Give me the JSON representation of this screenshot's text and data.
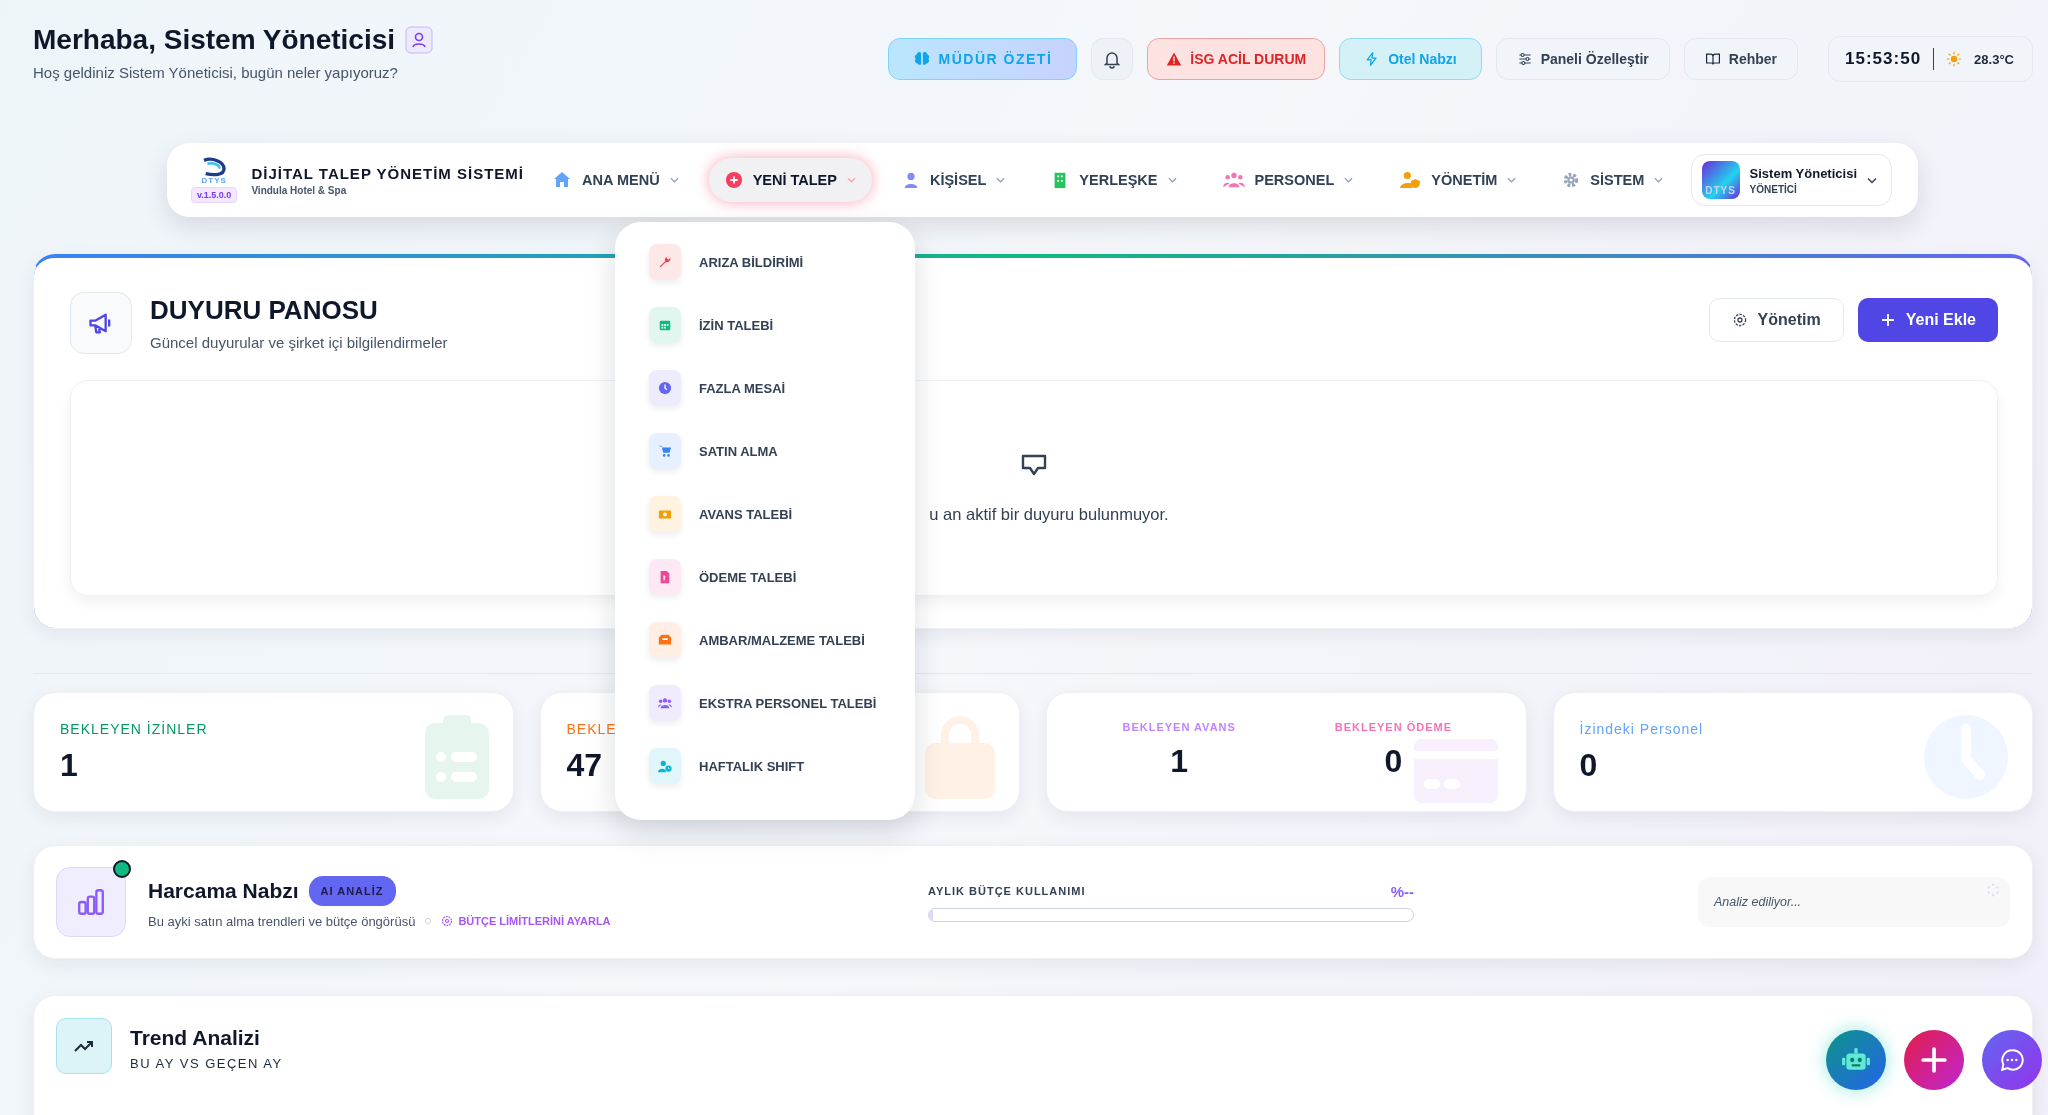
{
  "greeting": {
    "title": "Merhaba, Sistem Yöneticisi",
    "subtitle": "Hoş geldiniz Sistem Yöneticisi, bugün neler yapıyoruz?"
  },
  "top_actions": [
    {
      "kind": "summary",
      "label": "MÜDÜR ÖZETİ"
    },
    {
      "kind": "bell"
    },
    {
      "kind": "alert",
      "label": "İSG ACİL DURUM"
    },
    {
      "kind": "pulse",
      "label": "Otel Nabzı"
    },
    {
      "kind": "customize",
      "label": "Paneli Özelleştir"
    },
    {
      "kind": "guide",
      "label": "Rehber"
    }
  ],
  "status": {
    "time": "15:53:50",
    "temperature": "28.3°C"
  },
  "nav": {
    "logo_text": "DTYS",
    "version": "v.1.5.0.0",
    "title": "DİJİTAL TALEP YÖNETİM SİSTEMİ",
    "subtitle": "Vindula Hotel & Spa",
    "items": [
      {
        "kind": "home",
        "label": "ANA MENÜ",
        "selected": false
      },
      {
        "kind": "new",
        "label": "YENİ TALEP",
        "selected": true
      },
      {
        "kind": "person",
        "label": "KİŞİSEL",
        "selected": false
      },
      {
        "kind": "building",
        "label": "YERLEŞKE",
        "selected": false
      },
      {
        "kind": "people",
        "label": "PERSONEL",
        "selected": false
      },
      {
        "kind": "admin",
        "label": "YÖNETİM",
        "selected": false
      },
      {
        "kind": "gear",
        "label": "SİSTEM",
        "selected": false
      }
    ],
    "user": {
      "avatar_text": "DTYS",
      "name": "Sistem Yöneticisi",
      "role": "YÖNETİCİ"
    }
  },
  "dropdown": [
    {
      "kind": "wrench",
      "label": "ARIZA BİLDİRİMİ",
      "color": "#ef4444"
    },
    {
      "kind": "calendar",
      "label": "İZİN TALEBİ",
      "color": "#10b981"
    },
    {
      "kind": "clock",
      "label": "FAZLA MESAİ",
      "color": "#6366f1"
    },
    {
      "kind": "cart",
      "label": "SATIN ALMA",
      "color": "#3b82f6"
    },
    {
      "kind": "money",
      "label": "AVANS TALEBİ",
      "color": "#f59e0b"
    },
    {
      "kind": "doc",
      "label": "ÖDEME TALEBİ",
      "color": "#ec4899"
    },
    {
      "kind": "box",
      "label": "AMBAR/MALZEME TALEBİ",
      "color": "#f97316"
    },
    {
      "kind": "people",
      "label": "EKSTRA PERSONEL TALEBİ",
      "color": "#8b5cf6"
    },
    {
      "kind": "userclock",
      "label": "HAFTALIK SHIFT",
      "color": "#06b6d4"
    }
  ],
  "announcements": {
    "title": "DUYURU PANOSU",
    "subtitle": "Güncel duyurular ve şirket içi bilgilendirmeler",
    "buttons": [
      {
        "kind": "secondary",
        "label": "Yönetim"
      },
      {
        "kind": "primary",
        "label": "Yeni Ekle"
      }
    ],
    "empty_text": "u an aktif bir duyuru bulunmuyor."
  },
  "stats": [
    {
      "kind": "single",
      "label": "BEKLEYEN İZİNLER",
      "value": "1",
      "color": "#059669"
    },
    {
      "kind": "single",
      "label": "BEKLE",
      "value": "47",
      "color": "#f97316"
    },
    {
      "kind": "double",
      "parts": [
        {
          "label": "BEKLEYEN AVANS",
          "value": "1",
          "color": "#c084fc"
        },
        {
          "label": "BEKLEYEN ÖDEME",
          "value": "0",
          "color": "#f472b6"
        }
      ]
    },
    {
      "kind": "single",
      "label": "İzindeki Personel",
      "value": "0",
      "color": "#60a5fa"
    }
  ],
  "spending": {
    "title": "Harcama Nabzı",
    "badge": "AI ANALİZ",
    "subtitle": "Bu ayki satın alma trendleri ve bütçe öngörüsü",
    "link": "BÜTÇE LİMİTLERİNİ AYARLA",
    "budget_label": "AYLIK BÜTÇE KULLANIMI",
    "budget_value": "%--",
    "level": 0,
    "analysis": "Analiz ediliyor..."
  },
  "trend": {
    "title": "Trend Analizi",
    "subtitle": "BU AY VS GEÇEN AY"
  },
  "fabs": [
    {
      "kind": "robot"
    },
    {
      "kind": "plus"
    },
    {
      "kind": "chat"
    }
  ]
}
